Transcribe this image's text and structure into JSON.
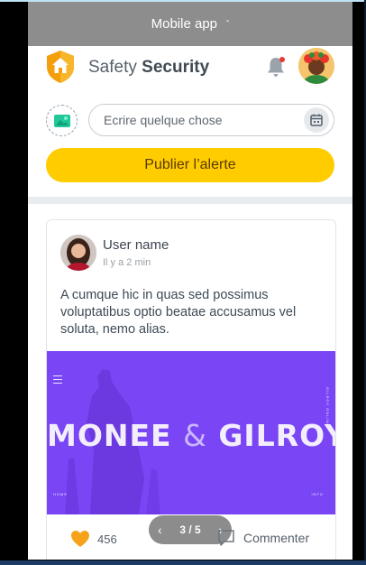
{
  "appbar": {
    "title": "Mobile app",
    "caret": "ˇ"
  },
  "header": {
    "brand_light": "Safety",
    "brand_bold": "Security"
  },
  "composer": {
    "placeholder": "Ecrire quelque chose"
  },
  "publish": {
    "label": "Publier l’alerte"
  },
  "post": {
    "user_name": "User name",
    "time": "Il y a 2 min",
    "text": "A cumque hic in quas sed possimus voluptatibus optio beatae accusamus vel soluta, nemo alias.",
    "image": {
      "title_left": "MONEE",
      "title_amp": "&",
      "title_right": "GILROY",
      "side_text": "GILROY ONLINE",
      "footer_left": "HOME",
      "footer_right": "INFO"
    },
    "pager": {
      "current": "3 / 5",
      "prev": "‹",
      "next": "›"
    },
    "likes": "456",
    "comment_label": "Commenter"
  },
  "colors": {
    "appbar": "#8d8d8d",
    "accent_yellow": "#ffcc00",
    "image_purple": "#7a45f5",
    "notification_dot": "#e53935"
  },
  "icons": {
    "logo": "shield-home-icon",
    "bell": "bell-icon",
    "media": "image-icon",
    "calendar": "calendar-icon",
    "like": "heart-icon",
    "comment": "comment-icon"
  }
}
